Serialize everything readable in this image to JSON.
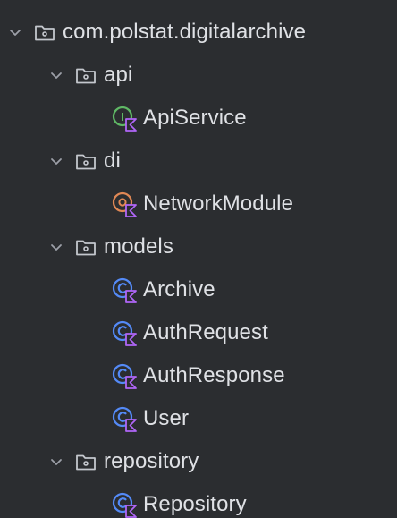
{
  "tree": {
    "root": {
      "label": "com.polstat.digitalarchive",
      "expanded": true,
      "icon": "package-folder-icon"
    },
    "packages": [
      {
        "label": "api",
        "expanded": true,
        "icon": "package-folder-icon",
        "children": [
          {
            "label": "ApiService",
            "kind": "kotlin-interface",
            "icon": "interface-icon"
          }
        ]
      },
      {
        "label": "di",
        "expanded": true,
        "icon": "package-folder-icon",
        "children": [
          {
            "label": "NetworkModule",
            "kind": "kotlin-object",
            "icon": "object-icon"
          }
        ]
      },
      {
        "label": "models",
        "expanded": true,
        "icon": "package-folder-icon",
        "children": [
          {
            "label": "Archive",
            "kind": "kotlin-class",
            "icon": "class-icon"
          },
          {
            "label": "AuthRequest",
            "kind": "kotlin-class",
            "icon": "class-icon"
          },
          {
            "label": "AuthResponse",
            "kind": "kotlin-class",
            "icon": "class-icon"
          },
          {
            "label": "User",
            "kind": "kotlin-class",
            "icon": "class-icon"
          }
        ]
      },
      {
        "label": "repository",
        "expanded": true,
        "icon": "package-folder-icon",
        "children": [
          {
            "label": "Repository",
            "kind": "kotlin-class",
            "icon": "class-icon"
          }
        ]
      }
    ]
  },
  "colors": {
    "background": "#2b2d30",
    "text": "#dfe1e5",
    "chevron": "#9da0a8",
    "folder": "#c4c7cd",
    "interface": "#5fb865",
    "object": "#e08855",
    "class": "#548af7",
    "kotlin_badge": "#b066f7"
  }
}
